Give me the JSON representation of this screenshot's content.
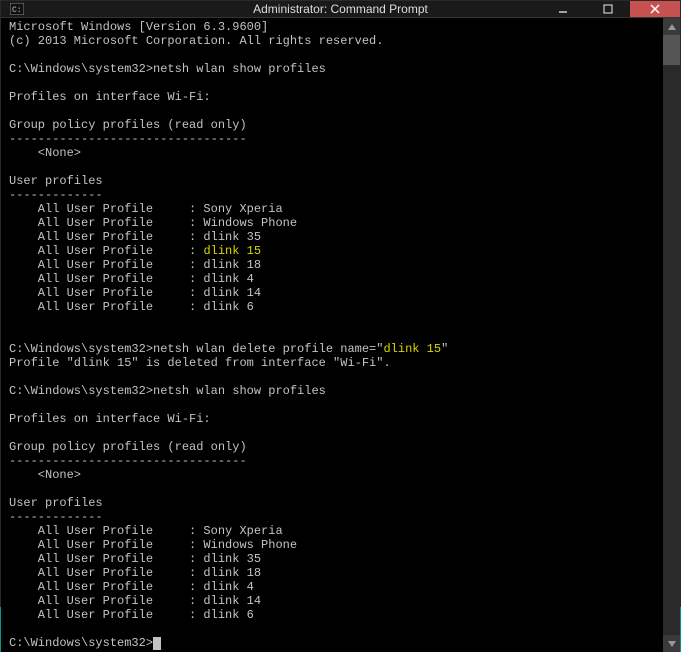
{
  "window": {
    "title": "Administrator: Command Prompt"
  },
  "header": {
    "line1": "Microsoft Windows [Version 6.3.9600]",
    "line2": "(c) 2013 Microsoft Corporation. All rights reserved."
  },
  "prompt": "C:\\Windows\\system32>",
  "cmd1": "netsh wlan show profiles",
  "out1": {
    "iface": "Profiles on interface Wi-Fi:",
    "gp_header": "Group policy profiles (read only)",
    "gp_dash": "---------------------------------",
    "none": "    <None>",
    "up_header": "User profiles",
    "up_dash": "-------------",
    "label": "    All User Profile     : ",
    "profiles": [
      "Sony Xperia",
      "Windows Phone",
      "dlink 35",
      "dlink 15",
      "dlink 18",
      "dlink 4",
      "dlink 14",
      "dlink 6"
    ],
    "highlight_index": 3
  },
  "cmd2_pre": "netsh wlan delete profile name=\"",
  "cmd2_hl": "dlink 15",
  "cmd2_post": "\"",
  "del_msg": "Profile \"dlink 15\" is deleted from interface \"Wi-Fi\".",
  "cmd3": "netsh wlan show profiles",
  "out2": {
    "iface": "Profiles on interface Wi-Fi:",
    "gp_header": "Group policy profiles (read only)",
    "gp_dash": "---------------------------------",
    "none": "    <None>",
    "up_header": "User profiles",
    "up_dash": "-------------",
    "label": "    All User Profile     : ",
    "profiles": [
      "Sony Xperia",
      "Windows Phone",
      "dlink 35",
      "dlink 18",
      "dlink 4",
      "dlink 14",
      "dlink 6"
    ]
  }
}
